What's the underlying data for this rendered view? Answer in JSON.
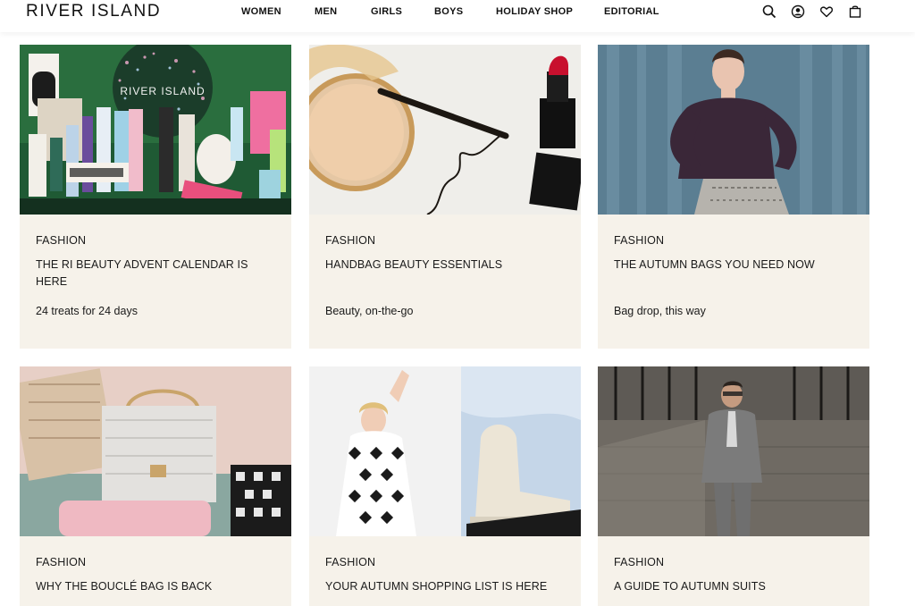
{
  "header": {
    "logo": "RIVER ISLAND",
    "nav": [
      "WOMEN",
      "MEN",
      "GIRLS",
      "BOYS",
      "HOLIDAY SHOP",
      "EDITORIAL"
    ],
    "icons": [
      "search-icon",
      "account-icon",
      "wishlist-heart-icon",
      "bag-icon"
    ]
  },
  "cards": [
    {
      "category": "FASHION",
      "title": "THE RI BEAUTY ADVENT CALENDAR IS HERE",
      "subtitle": "24 treats for 24 days",
      "image_text": "RIVER ISLAND"
    },
    {
      "category": "FASHION",
      "title": "HANDBAG BEAUTY ESSENTIALS",
      "subtitle": "Beauty, on-the-go"
    },
    {
      "category": "FASHION",
      "title": "THE AUTUMN BAGS YOU NEED NOW",
      "subtitle": "Bag drop, this way"
    },
    {
      "category": "FASHION",
      "title": "WHY THE BOUCLÉ BAG IS BACK",
      "subtitle": ""
    },
    {
      "category": "FASHION",
      "title": "YOUR AUTUMN SHOPPING LIST IS HERE",
      "subtitle": ""
    },
    {
      "category": "FASHION",
      "title": "A GUIDE TO AUTUMN SUITS",
      "subtitle": ""
    }
  ],
  "colors": {
    "card_bg": "#f6f2ea",
    "text": "#1a1a1a"
  }
}
